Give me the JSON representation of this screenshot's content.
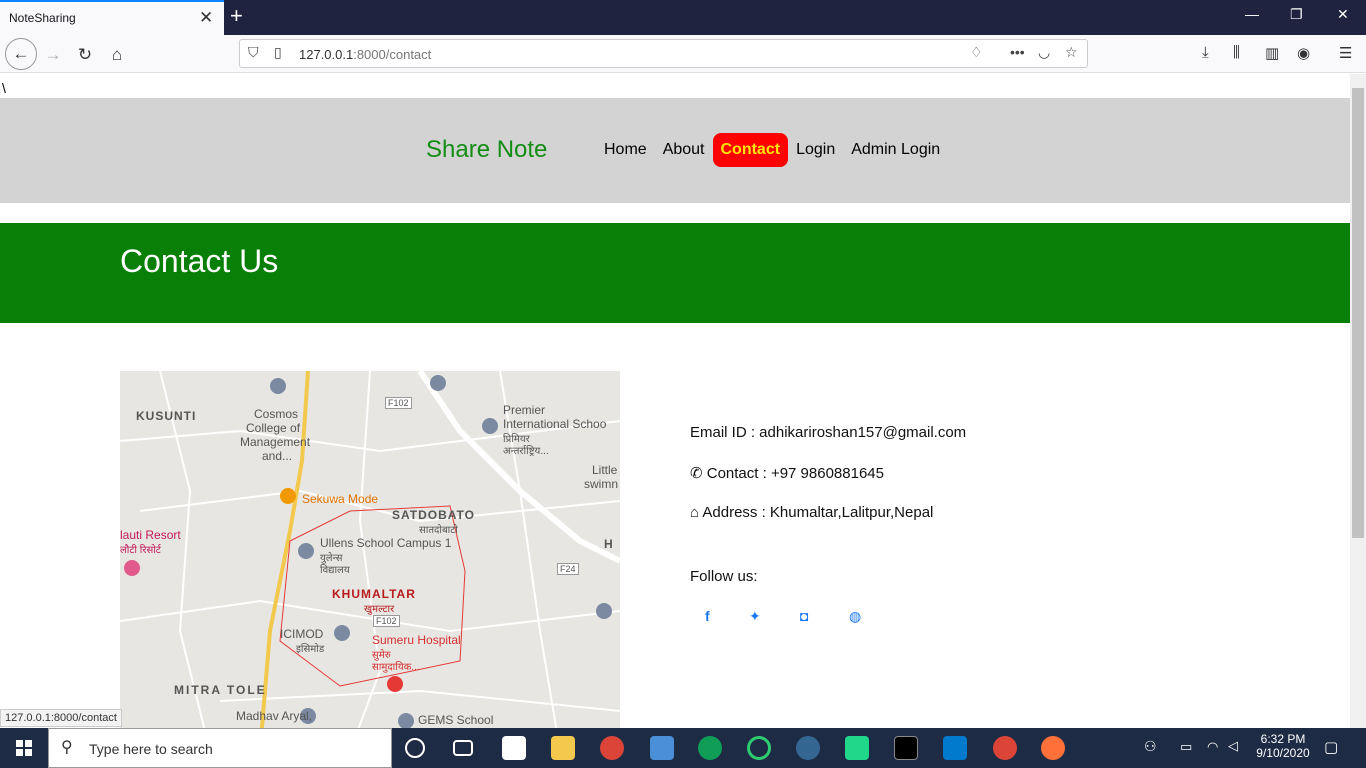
{
  "browser": {
    "tab_title": "NoteSharing",
    "url_host": "127.0.0.1",
    "url_path": ":8000/contact",
    "status_url": "127.0.0.1:8000/contact"
  },
  "page": {
    "stray_text": "\\",
    "brand": "Share Note",
    "nav": [
      "Home",
      "About",
      "Contact",
      "Login",
      "Admin Login"
    ],
    "active_nav": "Contact",
    "hero_title": "Contact Us",
    "email": "Email ID : adhikariroshan157@gmail.com",
    "contact": " Contact : +97 9860881645",
    "address": " Address : Khumaltar,Lalitpur,Nepal",
    "follow": "Follow us:",
    "social_icons": [
      "facebook-icon",
      "twitter-icon",
      "instagram-icon",
      "github-icon"
    ]
  },
  "map": {
    "labels": [
      "KUSUNTI",
      "Cosmos",
      "College of",
      "Management",
      "and...",
      "Premier",
      "International Schoo",
      "प्रिमियर",
      "अन्तर्राष्ट्रिय...",
      "Sekuwa Mode",
      "SATDOBATO",
      "सातदोबाटो",
      "lauti Resort",
      "लौटी रिसोर्ट",
      "Ullens School Campus 1",
      "युलेन्स",
      "विद्यालय",
      "KHUMALTAR",
      "खुमल्टार",
      "ICIMOD",
      "इसिमोड",
      "Sumeru Hospital",
      "सुमेरु",
      "सामुदायिक...",
      "MITRA TOLE",
      "Madhav Aryal,",
      "GEMS School",
      "Little",
      "swimn",
      "F102",
      "F102",
      "F24",
      "H"
    ]
  },
  "taskbar": {
    "search_placeholder": "Type here to search",
    "time": "6:32 PM",
    "date": "9/10/2020"
  }
}
